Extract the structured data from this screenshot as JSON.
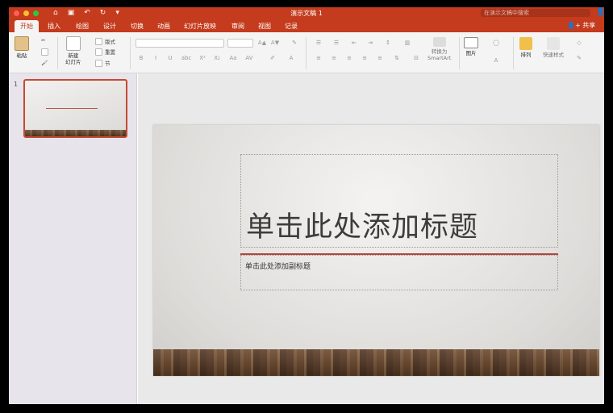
{
  "window": {
    "title": "演示文稿 1"
  },
  "quick_access": [
    "⌂",
    "▣",
    "↶",
    "↻",
    "▾"
  ],
  "search": {
    "placeholder": "在演示文稿中搜索"
  },
  "tabs": [
    {
      "label": "开始",
      "active": true
    },
    {
      "label": "插入"
    },
    {
      "label": "绘图"
    },
    {
      "label": "设计"
    },
    {
      "label": "切换"
    },
    {
      "label": "动画"
    },
    {
      "label": "幻灯片放映"
    },
    {
      "label": "审阅"
    },
    {
      "label": "视图"
    },
    {
      "label": "记录"
    }
  ],
  "share_label": "共享",
  "ribbon": {
    "paste": "粘贴",
    "new_slide": "新建\n幻灯片",
    "layout": "版式",
    "reset": "重置",
    "section": "节",
    "convert_smartart": "转换为\nSmartArt",
    "picture": "图片",
    "arrange": "排列",
    "quick_styles": "快速样式",
    "font_sizes": [
      "A▲",
      "A▼"
    ],
    "format_buttons": [
      "B",
      "I",
      "U",
      "abc",
      "X²",
      "X₂",
      "Aa",
      "A"
    ]
  },
  "slides_panel": {
    "slide_number": "1"
  },
  "slide": {
    "title_placeholder": "单击此处添加标题",
    "subtitle_placeholder": "单击此处添加副标题"
  },
  "colors": {
    "accent": "#c43b1d",
    "title_rule": "#b2453b"
  }
}
